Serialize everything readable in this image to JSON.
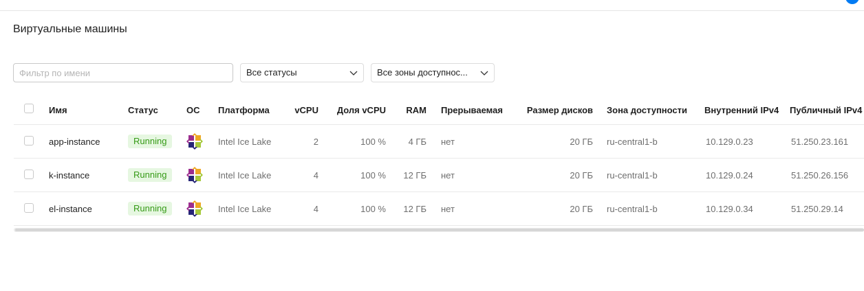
{
  "page": {
    "title": "Виртуальные машины"
  },
  "filters": {
    "name_placeholder": "Фильтр по имени",
    "status_select": "Все статусы",
    "zone_select": "Все зоны доступнос..."
  },
  "table": {
    "headers": {
      "name": "Имя",
      "status": "Статус",
      "os": "ОС",
      "platform": "Платформа",
      "vcpu": "vCPU",
      "vcpu_share": "Доля vCPU",
      "ram": "RAM",
      "preemptible": "Прерываемая",
      "disk_size": "Размер дисков",
      "zone": "Зона доступности",
      "internal_ip": "Внутренний IPv4",
      "public_ip": "Публичный IPv4"
    },
    "rows": [
      {
        "name": "app-instance",
        "status": "Running",
        "os_icon": "centos-icon",
        "platform": "Intel Ice Lake",
        "vcpu": "2",
        "vcpu_share": "100 %",
        "ram": "4 ГБ",
        "preemptible": "нет",
        "disk_size": "20 ГБ",
        "zone": "ru-central1-b",
        "internal_ip": "10.129.0.23",
        "public_ip": "51.250.23.161"
      },
      {
        "name": "k-instance",
        "status": "Running",
        "os_icon": "centos-icon",
        "platform": "Intel Ice Lake",
        "vcpu": "4",
        "vcpu_share": "100 %",
        "ram": "12 ГБ",
        "preemptible": "нет",
        "disk_size": "20 ГБ",
        "zone": "ru-central1-b",
        "internal_ip": "10.129.0.24",
        "public_ip": "51.250.26.156"
      },
      {
        "name": "el-instance",
        "status": "Running",
        "os_icon": "centos-icon",
        "platform": "Intel Ice Lake",
        "vcpu": "4",
        "vcpu_share": "100 %",
        "ram": "12 ГБ",
        "preemptible": "нет",
        "disk_size": "20 ГБ",
        "zone": "ru-central1-b",
        "internal_ip": "10.129.0.34",
        "public_ip": "51.250.29.14"
      }
    ]
  },
  "colors": {
    "running_bg": "#e6f7e1",
    "running_text": "#359a16",
    "accent": "#027bf3"
  }
}
